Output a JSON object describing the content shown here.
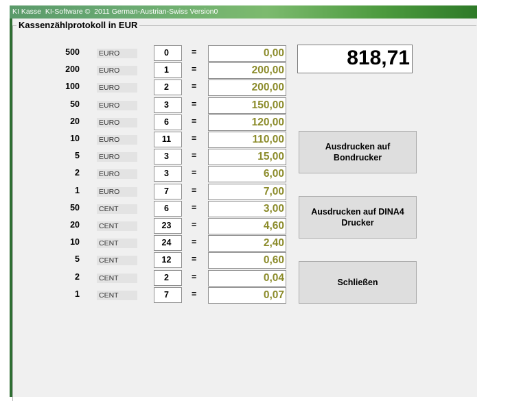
{
  "window": {
    "title": "KI Kasse  KI-Software ©  2011 German-Austrian-Swiss Version0"
  },
  "group": {
    "title": "Kassenzählprotokoll in EUR"
  },
  "rows": [
    {
      "denomination": "500",
      "unit": "EURO",
      "count": "0",
      "equals": "=",
      "amount": "0,00"
    },
    {
      "denomination": "200",
      "unit": "EURO",
      "count": "1",
      "equals": "=",
      "amount": "200,00"
    },
    {
      "denomination": "100",
      "unit": "EURO",
      "count": "2",
      "equals": "=",
      "amount": "200,00"
    },
    {
      "denomination": "50",
      "unit": "EURO",
      "count": "3",
      "equals": "=",
      "amount": "150,00"
    },
    {
      "denomination": "20",
      "unit": "EURO",
      "count": "6",
      "equals": "=",
      "amount": "120,00"
    },
    {
      "denomination": "10",
      "unit": "EURO",
      "count": "11",
      "equals": "=",
      "amount": "110,00"
    },
    {
      "denomination": "5",
      "unit": "EURO",
      "count": "3",
      "equals": "=",
      "amount": "15,00"
    },
    {
      "denomination": "2",
      "unit": "EURO",
      "count": "3",
      "equals": "=",
      "amount": "6,00"
    },
    {
      "denomination": "1",
      "unit": "EURO",
      "count": "7",
      "equals": "=",
      "amount": "7,00"
    },
    {
      "denomination": "50",
      "unit": "CENT",
      "count": "6",
      "equals": "=",
      "amount": "3,00"
    },
    {
      "denomination": "20",
      "unit": "CENT",
      "count": "23",
      "equals": "=",
      "amount": "4,60"
    },
    {
      "denomination": "10",
      "unit": "CENT",
      "count": "24",
      "equals": "=",
      "amount": "2,40"
    },
    {
      "denomination": "5",
      "unit": "CENT",
      "count": "12",
      "equals": "=",
      "amount": "0,60"
    },
    {
      "denomination": "2",
      "unit": "CENT",
      "count": "2",
      "equals": "=",
      "amount": "0,04"
    },
    {
      "denomination": "1",
      "unit": "CENT",
      "count": "7",
      "equals": "=",
      "amount": "0,07"
    }
  ],
  "total": "818,71",
  "buttons": {
    "print_receipt": "Ausdrucken auf Bondrucker",
    "print_a4": "Ausdrucken auf DINA4 Drucker",
    "close": "Schließen"
  },
  "colors": {
    "amount_text": "#8b8b2a",
    "titlebar_accent": "#4c9a3e"
  }
}
